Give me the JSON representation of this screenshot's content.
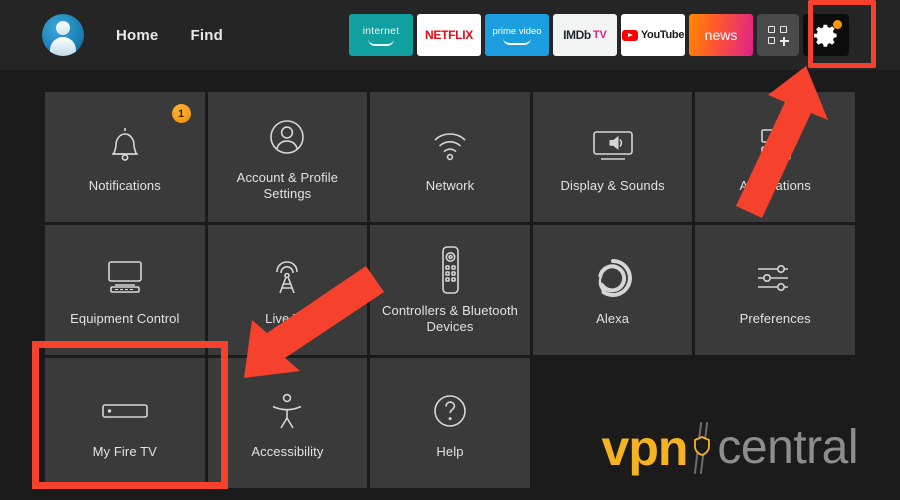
{
  "topnav": {
    "avatar_name": "profile-avatar",
    "links": [
      {
        "label": "Home"
      },
      {
        "label": "Find"
      }
    ],
    "app_tiles": [
      {
        "id": "internet",
        "label": "internet"
      },
      {
        "id": "netflix",
        "label": "NETFLIX"
      },
      {
        "id": "prime-video",
        "label": "prime video"
      },
      {
        "id": "imdb-tv",
        "label": "IMDb",
        "label2": "TV"
      },
      {
        "id": "youtube",
        "label": "YouTube"
      },
      {
        "id": "news",
        "label": "news"
      }
    ],
    "apps_grid_label": "app-grid-add",
    "settings_label": "Settings",
    "settings_has_notification_dot": true
  },
  "settings_grid": {
    "rows": [
      [
        {
          "id": "notifications",
          "label": "Notifications",
          "icon": "bell-icon",
          "badge": "1"
        },
        {
          "id": "account-profile-settings",
          "label": "Account & Profile Settings",
          "icon": "person-circle-icon"
        },
        {
          "id": "network",
          "label": "Network",
          "icon": "wifi-icon"
        },
        {
          "id": "display-sounds",
          "label": "Display & Sounds",
          "icon": "tv-speaker-icon"
        },
        {
          "id": "applications",
          "label": "Applications",
          "icon": "applications-icon"
        }
      ],
      [
        {
          "id": "equipment-control",
          "label": "Equipment Control",
          "icon": "tv-soundbar-icon"
        },
        {
          "id": "live-tv",
          "label": "Live TV",
          "icon": "antenna-icon"
        },
        {
          "id": "controllers-bluetooth-devices",
          "label": "Controllers & Bluetooth Devices",
          "icon": "remote-icon"
        },
        {
          "id": "alexa",
          "label": "Alexa",
          "icon": "alexa-ring-icon"
        },
        {
          "id": "preferences",
          "label": "Preferences",
          "icon": "sliders-icon"
        }
      ],
      [
        {
          "id": "my-fire-tv",
          "label": "My Fire TV",
          "icon": "fire-tv-stick-icon",
          "highlighted": true
        },
        {
          "id": "accessibility",
          "label": "Accessibility",
          "icon": "accessibility-icon"
        },
        {
          "id": "help",
          "label": "Help",
          "icon": "question-circle-icon"
        },
        {
          "id": "blank-1",
          "label": "",
          "icon": ""
        },
        {
          "id": "blank-2",
          "label": "",
          "icon": ""
        }
      ]
    ]
  },
  "annotations": {
    "arrow_to_settings": "red-arrow-pointing-to-settings",
    "arrow_to_my_fire_tv": "red-arrow-pointing-to-my-fire-tv",
    "highlight_settings": "red-box-around-settings",
    "highlight_my_fire_tv": "red-box-around-my-fire-tv",
    "accent_color": "#f6412d"
  },
  "watermark": {
    "brand_part1": "vpn",
    "brand_part2": "central",
    "color1": "#f5b324",
    "color2": "#8d8d8d"
  }
}
